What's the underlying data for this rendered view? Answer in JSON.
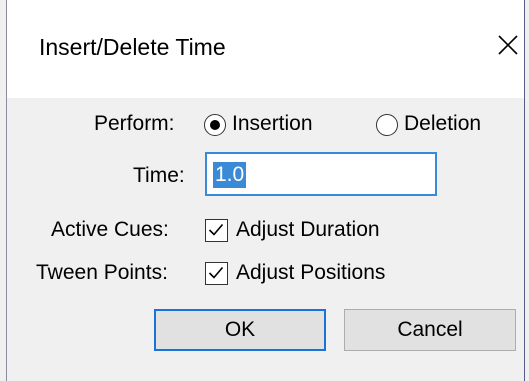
{
  "window": {
    "title": "Insert/Delete Time"
  },
  "perform": {
    "label": "Perform:",
    "options": [
      {
        "label": "Insertion",
        "selected": true
      },
      {
        "label": "Deletion",
        "selected": false
      }
    ]
  },
  "time": {
    "label": "Time:",
    "value": "1.0"
  },
  "active_cues": {
    "label": "Active Cues:",
    "checkbox_label": "Adjust Duration",
    "checked": true
  },
  "tween_points": {
    "label": "Tween Points:",
    "checkbox_label": "Adjust Positions",
    "checked": true
  },
  "buttons": {
    "ok": "OK",
    "cancel": "Cancel"
  },
  "colors": {
    "accent": "#3a8ad8",
    "dialog_bg": "#f0f0f0"
  }
}
